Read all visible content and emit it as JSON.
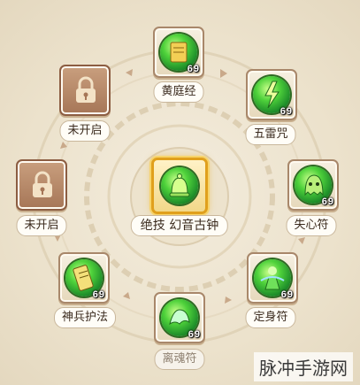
{
  "skill_ring": {
    "center": {
      "label": "绝技  幻音古钟",
      "icon": "bell-skill-icon"
    },
    "skills": [
      {
        "id": "huang",
        "label": "黄庭经",
        "level": "69",
        "icon": "scroll-skill-icon"
      },
      {
        "id": "wulei",
        "label": "五雷咒",
        "level": "69",
        "icon": "thunder-skill-icon"
      },
      {
        "id": "shixin",
        "label": "失心符",
        "level": "69",
        "icon": "ghost-skill-icon"
      },
      {
        "id": "dingshen",
        "label": "定身符",
        "level": "69",
        "icon": "figure-skill-icon"
      },
      {
        "id": "lihun",
        "label": "离魂符",
        "level": "69",
        "icon": "soul-skill-icon"
      },
      {
        "id": "shenbing",
        "label": "神兵护法",
        "level": "69",
        "icon": "talisman-skill-icon"
      }
    ],
    "locked": [
      {
        "id": "locked-top",
        "label": "未开启",
        "icon": "padlock-icon"
      },
      {
        "id": "locked-left",
        "label": "未开启",
        "icon": "padlock-icon"
      }
    ]
  },
  "watermark": "脉冲手游网",
  "colors": {
    "accent": "#e0a01c",
    "orb": "#4fd23b",
    "locked": "#a67657"
  }
}
